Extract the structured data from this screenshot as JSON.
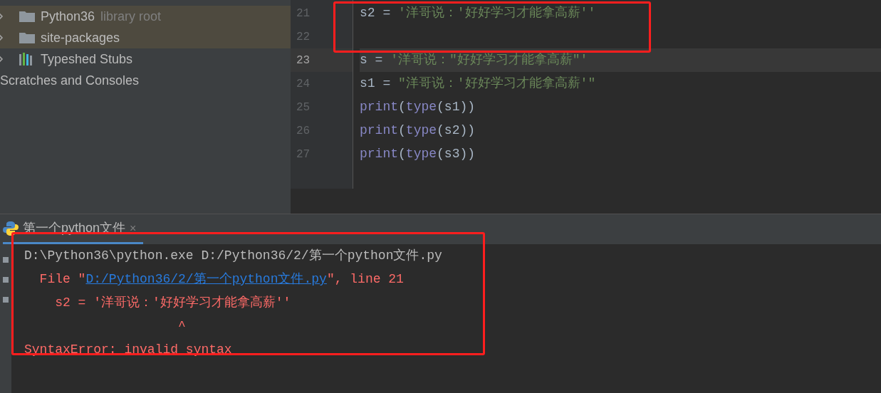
{
  "sidebar": {
    "items": [
      {
        "kind": "folder",
        "label": "Python36",
        "note": "library root",
        "selected": true
      },
      {
        "kind": "folder",
        "label": "site-packages",
        "selected": true
      },
      {
        "kind": "stubs",
        "label": "Typeshed Stubs",
        "selected": false
      },
      {
        "kind": "scratches",
        "label": "Scratches and Consoles",
        "selected": false
      }
    ]
  },
  "editor": {
    "lines": [
      {
        "number": "21",
        "current": false,
        "tokens": [
          {
            "kind": "plain",
            "text": "s2 = "
          },
          {
            "kind": "string",
            "text": "'洋哥说：'好好学习才能拿高薪''"
          }
        ]
      },
      {
        "number": "22",
        "current": false
      },
      {
        "number": "23",
        "current": true,
        "tokens": [
          {
            "kind": "plain",
            "text": "s = "
          },
          {
            "kind": "string",
            "text": "'洋哥说：\"好好学习才能拿高薪\"'"
          }
        ]
      },
      {
        "number": "24",
        "current": false,
        "tokens": [
          {
            "kind": "plain",
            "text": "s1 = "
          },
          {
            "kind": "string",
            "text": "\"洋哥说：'好好学习才能拿高薪'\""
          }
        ]
      },
      {
        "number": "25",
        "current": false,
        "tokens": [
          {
            "kind": "builtin",
            "text": "print"
          },
          {
            "kind": "plain",
            "text": "("
          },
          {
            "kind": "builtin",
            "text": "type"
          },
          {
            "kind": "plain",
            "text": "(s1))"
          }
        ]
      },
      {
        "number": "26",
        "current": false,
        "tokens": [
          {
            "kind": "builtin",
            "text": "print"
          },
          {
            "kind": "plain",
            "text": "("
          },
          {
            "kind": "builtin",
            "text": "type"
          },
          {
            "kind": "plain",
            "text": "(s2))"
          }
        ]
      },
      {
        "number": "27",
        "current": false,
        "tokens": [
          {
            "kind": "builtin",
            "text": "print"
          },
          {
            "kind": "plain",
            "text": "("
          },
          {
            "kind": "builtin",
            "text": "type"
          },
          {
            "kind": "plain",
            "text": "(s3))"
          }
        ]
      }
    ]
  },
  "run_panel": {
    "tab": {
      "label": "第一个python文件",
      "close": "×",
      "selected": true
    },
    "output": [
      [
        {
          "kind": "plain",
          "text": "D:\\Python36\\python.exe D:/Python36/2/第一个python文件.py"
        }
      ],
      [
        {
          "kind": "error",
          "text": "  File \""
        },
        {
          "kind": "link",
          "text": "D:/Python36/2/第一个python文件.py"
        },
        {
          "kind": "error",
          "text": "\", line 21"
        }
      ],
      [
        {
          "kind": "error",
          "text": "    s2 = '洋哥说：'好好学习才能拿高薪''"
        }
      ],
      [
        {
          "kind": "error",
          "text": "                    ^"
        }
      ],
      [
        {
          "kind": "error",
          "text": "SyntaxError: invalid syntax"
        }
      ]
    ]
  }
}
